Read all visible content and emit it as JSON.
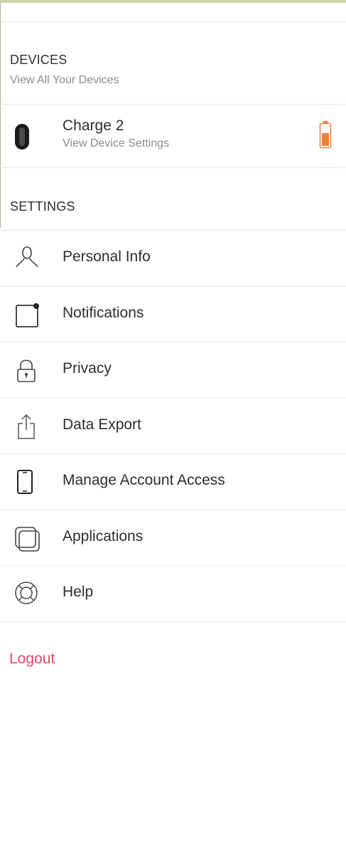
{
  "devices": {
    "title": "DEVICES",
    "subtitle": "View All Your Devices",
    "items": [
      {
        "name": "Charge 2",
        "subtitle": "View Device Settings",
        "battery_color": "#f07f3c"
      }
    ]
  },
  "settings": {
    "title": "SETTINGS",
    "items": [
      {
        "label": "Personal Info",
        "icon": "person-icon"
      },
      {
        "label": "Notifications",
        "icon": "notification-icon"
      },
      {
        "label": "Privacy",
        "icon": "lock-icon"
      },
      {
        "label": "Data Export",
        "icon": "export-icon"
      },
      {
        "label": "Manage Account Access",
        "icon": "phone-icon"
      },
      {
        "label": "Applications",
        "icon": "applications-icon"
      },
      {
        "label": "Help",
        "icon": "lifebuoy-icon"
      }
    ]
  },
  "logout_label": "Logout",
  "colors": {
    "accent": "#e5486a",
    "header_bar": "#c8d3ad",
    "divider": "#e6e6e6"
  }
}
